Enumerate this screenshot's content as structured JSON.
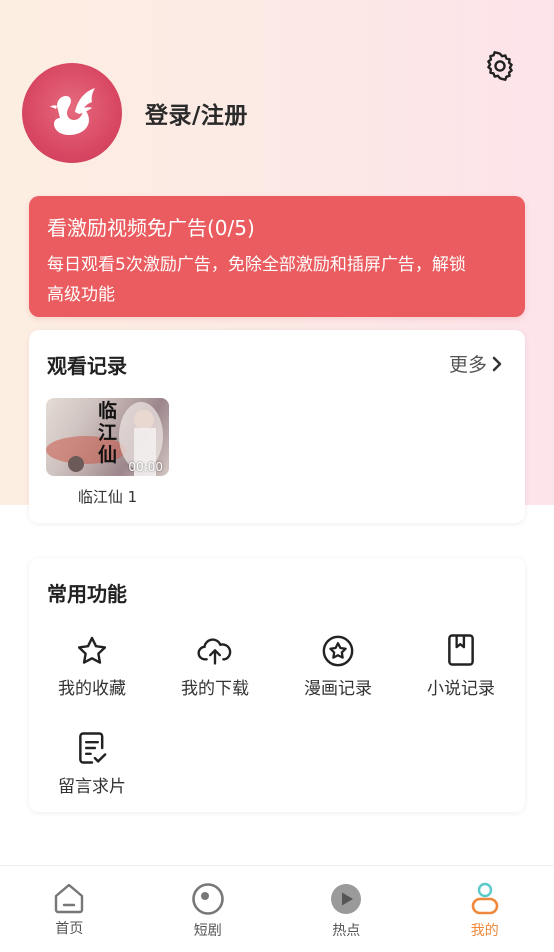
{
  "header": {
    "login_label": "登录/注册",
    "settings_icon": "gear-icon",
    "avatar_icon": "swan-logo"
  },
  "banner": {
    "title": "看激励视频免广告(0/5)",
    "description_line1": "每日观看5次激励广告，免除全部激励和插屏广告，解锁",
    "description_line2": "高级功能",
    "color": "#ea5c5f"
  },
  "history": {
    "title": "观看记录",
    "more_label": "更多",
    "items": [
      {
        "caption": "临江仙 1",
        "duration": "00:00",
        "poster_text": "临江仙"
      }
    ]
  },
  "functions": {
    "title": "常用功能",
    "items": [
      {
        "label": "我的收藏",
        "icon": "star-icon"
      },
      {
        "label": "我的下载",
        "icon": "cloud-upload-icon"
      },
      {
        "label": "漫画记录",
        "icon": "star-circle-icon"
      },
      {
        "label": "小说记录",
        "icon": "book-icon"
      },
      {
        "label": "留言求片",
        "icon": "document-check-icon"
      }
    ]
  },
  "tabbar": {
    "items": [
      {
        "label": "首页",
        "icon": "home-icon",
        "active": false
      },
      {
        "label": "短剧",
        "icon": "circle-dot-icon",
        "active": false
      },
      {
        "label": "热点",
        "icon": "play-circle-icon",
        "active": false
      },
      {
        "label": "我的",
        "icon": "profile-icon",
        "active": true
      }
    ],
    "accent": "#f0883c"
  }
}
